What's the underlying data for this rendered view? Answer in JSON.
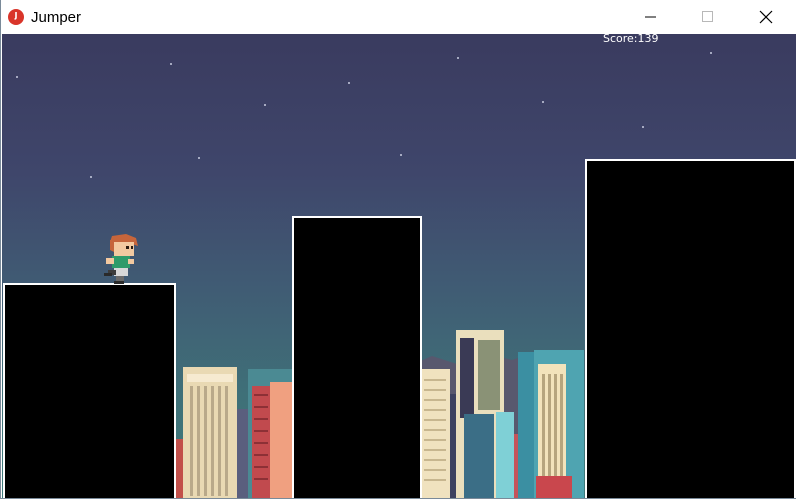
{
  "window": {
    "title": "Jumper",
    "controls": [
      "minimize",
      "maximize",
      "close"
    ]
  },
  "hud": {
    "score_text": "Score:139"
  },
  "icons": {
    "app": "red-circle-app-icon",
    "minimize": "minimize-icon",
    "maximize": "maximize-icon",
    "close": "close-icon"
  },
  "colors": {
    "platform_fill": "#000000",
    "platform_edge": "#ffffff",
    "sky_top": "#3a3b5f",
    "sky_bottom": "#3e7b7b"
  }
}
